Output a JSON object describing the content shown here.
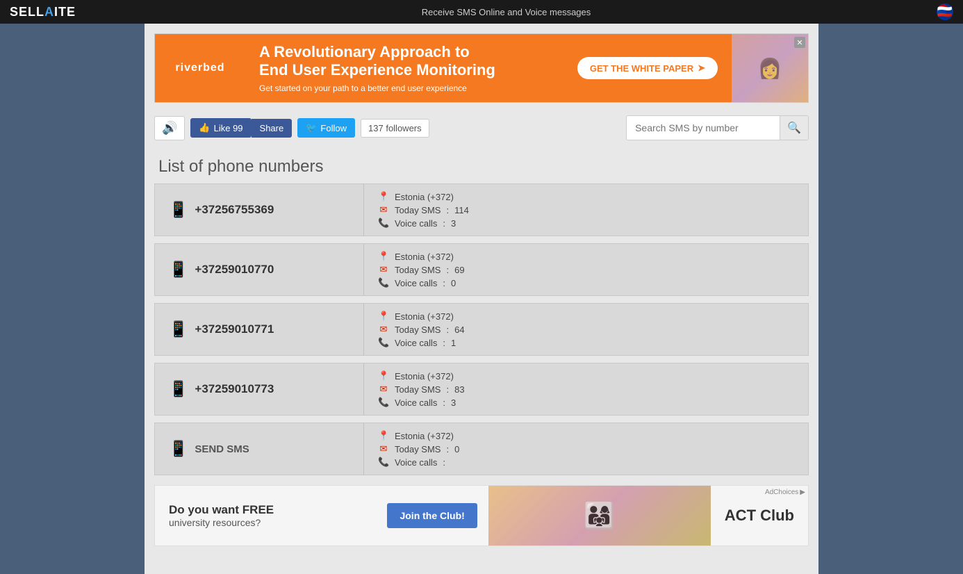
{
  "topbar": {
    "logo": "SELL",
    "logo_accent": "A",
    "logo_end": "ITE",
    "message": "Receive SMS Online and Voice messages",
    "flag_emoji": "🇷🇺"
  },
  "banner": {
    "brand": "riverbed",
    "headline": "A Revolutionary Approach to\nEnd User Experience Monitoring",
    "subtext": "Get started on your path to a  better end user experience",
    "cta": "GET THE WHITE PAPER",
    "close": "✕"
  },
  "toolbar": {
    "sound_icon": "🔊",
    "fb_like_label": "Like 99",
    "fb_share_label": "Share",
    "tw_follow_label": "Follow",
    "tw_icon": "🐦",
    "followers_count": "137",
    "followers_label": "followers",
    "search_placeholder": "Search SMS by number",
    "search_icon": "🔍"
  },
  "page_title": "List of phone numbers",
  "phones": [
    {
      "number": "+37256755369",
      "country": "Estonia (+372)",
      "sms_label": "Today SMS",
      "sms_count": "114",
      "voice_label": "Voice calls",
      "voice_count": "3"
    },
    {
      "number": "+37259010770",
      "country": "Estonia (+372)",
      "sms_label": "Today SMS",
      "sms_count": "69",
      "voice_label": "Voice calls",
      "voice_count": "0"
    },
    {
      "number": "+37259010771",
      "country": "Estonia (+372)",
      "sms_label": "Today SMS",
      "sms_count": "64",
      "voice_label": "Voice calls",
      "voice_count": "1"
    },
    {
      "number": "+37259010773",
      "country": "Estonia (+372)",
      "sms_label": "Today SMS",
      "sms_count": "83",
      "voice_label": "Voice calls",
      "voice_count": "3"
    }
  ],
  "send_sms": {
    "label": "SEND SMS",
    "country": "Estonia (+372)",
    "sms_label": "Today SMS",
    "sms_count": "0",
    "voice_label": "Voice calls",
    "voice_count": ""
  },
  "bottom_ad": {
    "ad_choices": "AdChoices",
    "title": "Do you want FREE",
    "subtitle": "university resources?",
    "cta": "Join the Club!",
    "brand": "ACT Club"
  }
}
